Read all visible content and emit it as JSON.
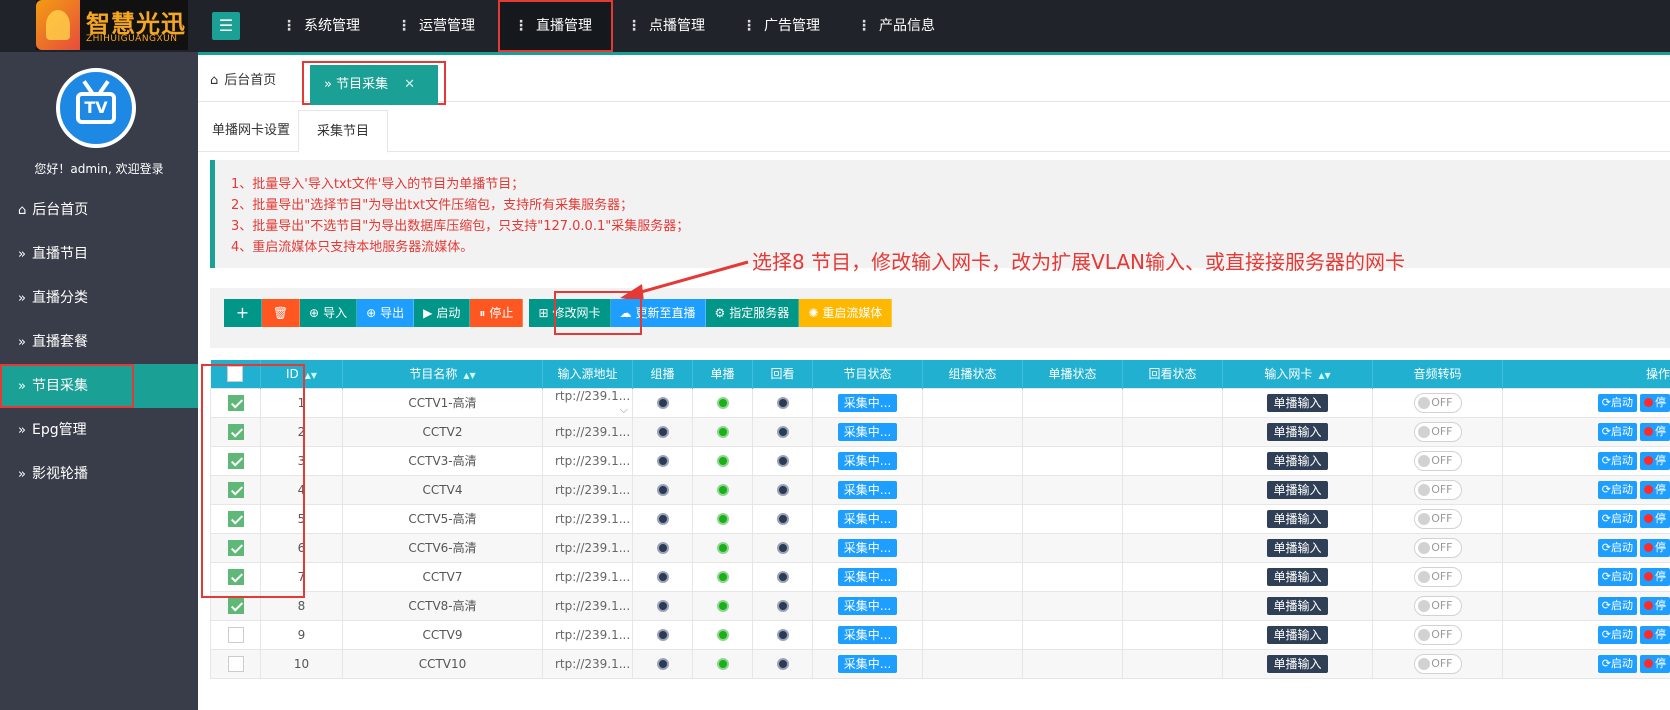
{
  "logo": {
    "title": "智慧光迅",
    "subtitle": "ZHIHUIGUANGXUN"
  },
  "nav": [
    {
      "label": "系统管理"
    },
    {
      "label": "运营管理"
    },
    {
      "label": "直播管理"
    },
    {
      "label": "点播管理"
    },
    {
      "label": "广告管理"
    },
    {
      "label": "产品信息"
    }
  ],
  "user": {
    "welcome": "您好！admin, 欢迎登录",
    "avatar_text": "TV"
  },
  "sidebar": [
    {
      "label": "后台首页",
      "icon": "home-icon"
    },
    {
      "label": "直播节目",
      "icon": "double-chevron-icon"
    },
    {
      "label": "直播分类",
      "icon": "double-chevron-icon"
    },
    {
      "label": "直播套餐",
      "icon": "double-chevron-icon"
    },
    {
      "label": "节目采集",
      "icon": "double-chevron-icon"
    },
    {
      "label": "Epg管理",
      "icon": "double-chevron-icon"
    },
    {
      "label": "影视轮播",
      "icon": "double-chevron-icon"
    }
  ],
  "tabs": {
    "home": "后台首页",
    "active": "节目采集"
  },
  "subtabs": [
    "单播网卡设置",
    "采集节目"
  ],
  "notice": [
    "1、批量导入'导入txt文件'导入的节目为单播节目；",
    "2、批量导出\"选择节目\"为导出txt文件压缩包，支持所有采集服务器；",
    "3、批量导出\"不选节目\"为导出数据库压缩包，只支持\"127.0.0.1\"采集服务器；",
    "4、重启流媒体只支持本地服务器流媒体。"
  ],
  "annotation": "选择8 节目，修改输入网卡，改为扩展VLAN输入、或直接接服务器的网卡",
  "toolbar": {
    "add": "+",
    "import": "导入",
    "export": "导出",
    "start": "启动",
    "stop": "停止",
    "modify_nic": "修改网卡",
    "update_live": "更新至直播",
    "assign_server": "指定服务器",
    "restart_media": "重启流媒体"
  },
  "table": {
    "headers": [
      "ID",
      "节目名称",
      "输入源地址",
      "组播",
      "单播",
      "回看",
      "节目状态",
      "组播状态",
      "单播状态",
      "回看状态",
      "输入网卡",
      "音频转码",
      "操作"
    ],
    "rows": [
      {
        "id": "1",
        "name": "CCTV1-高清",
        "url": "rtp://239.1...",
        "checked": true
      },
      {
        "id": "2",
        "name": "CCTV2",
        "url": "rtp://239.1...",
        "checked": true
      },
      {
        "id": "3",
        "name": "CCTV3-高清",
        "url": "rtp://239.1...",
        "checked": true
      },
      {
        "id": "4",
        "name": "CCTV4",
        "url": "rtp://239.1...",
        "checked": true
      },
      {
        "id": "5",
        "name": "CCTV5-高清",
        "url": "rtp://239.1...",
        "checked": true
      },
      {
        "id": "6",
        "name": "CCTV6-高清",
        "url": "rtp://239.1...",
        "checked": true
      },
      {
        "id": "7",
        "name": "CCTV7",
        "url": "rtp://239.1...",
        "checked": true
      },
      {
        "id": "8",
        "name": "CCTV8-高清",
        "url": "rtp://239.1...",
        "checked": true
      },
      {
        "id": "9",
        "name": "CCTV9",
        "url": "rtp://239.1...",
        "checked": false
      },
      {
        "id": "10",
        "name": "CCTV10",
        "url": "rtp://239.1...",
        "checked": false
      }
    ],
    "status_label": "采集中...",
    "nic_label": "单播输入",
    "audio_label": "OFF",
    "op_start": "启动",
    "op_stop": "停"
  },
  "colors": {
    "accent": "#1aa094",
    "header_bg": "#21b0cf",
    "highlight": "#e53935",
    "topbar": "#20242a",
    "sidebar": "#393d49"
  }
}
